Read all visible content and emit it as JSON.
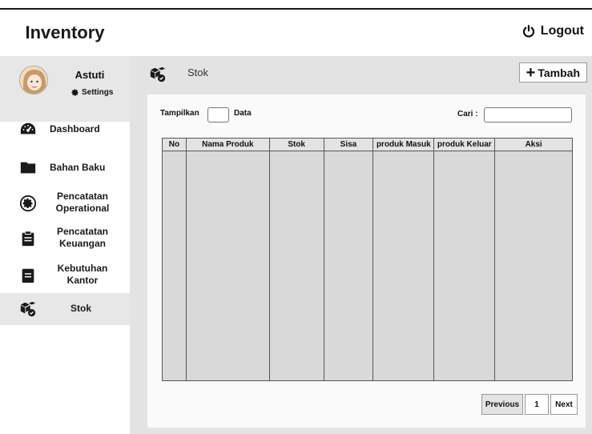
{
  "app": {
    "title": "Inventory"
  },
  "user": {
    "name": "Astuti",
    "settings_label": "Settings"
  },
  "header": {
    "logout_label": "Logout"
  },
  "sidebar": {
    "items": [
      {
        "label": "Dashboard",
        "icon": "dashboard-icon"
      },
      {
        "label": "Bahan Baku",
        "icon": "folder-icon"
      },
      {
        "label": "Pencatatan Operational",
        "icon": "gear-icon"
      },
      {
        "label": "Pencatatan Keuangan",
        "icon": "clipboard-icon"
      },
      {
        "label": "Kebutuhan Kantor",
        "icon": "document-icon"
      },
      {
        "label": "Stok",
        "icon": "boxes-icon",
        "active": true
      }
    ]
  },
  "main": {
    "title": "Stok",
    "add_button": {
      "symbol": "+",
      "label": "Tambah"
    },
    "show_label": "Tampilkan",
    "data_label": "Data",
    "search_label": "Cari :",
    "search_value": "",
    "table": {
      "columns": [
        "No",
        "Nama Produk",
        "Stok",
        "Sisa",
        "produk Masuk",
        "produk Keluar",
        "Aksi"
      ],
      "rows": []
    },
    "pagination": {
      "previous": "Previous",
      "current": "1",
      "next": "Next"
    }
  },
  "colors": {
    "panel": "#e3e3e3",
    "active_nav": "#e7e7e7",
    "table_fill": "#d9d9d9"
  }
}
